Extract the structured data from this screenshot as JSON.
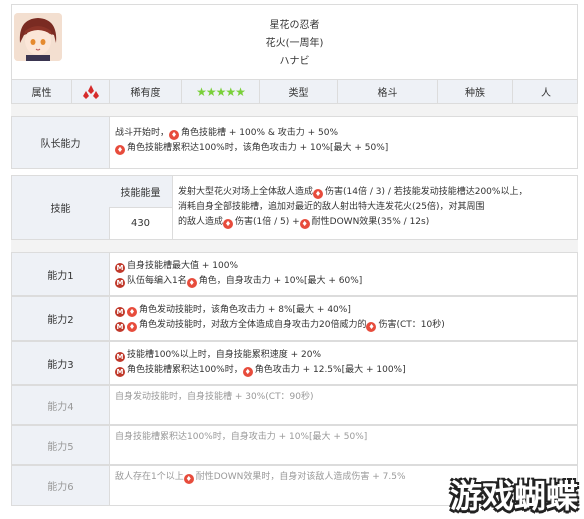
{
  "header": {
    "name_cn": "星花の忍者",
    "name_title": "花火(一周年)",
    "name_kana": "ハナビ"
  },
  "attrs": {
    "attr_label": "属性",
    "rarity_label": "稀有度",
    "stars": "★★★★★",
    "type_label": "类型",
    "type_value": "格斗",
    "race_label": "种族",
    "race_value": "人"
  },
  "leader": {
    "label": "队长能力",
    "line1_a": "战斗开始时，",
    "line1_b": "角色技能槽 + 100% & 攻击力 + 50%",
    "line2_b": "角色技能槽累积达100%时，该角色攻击力 + 10%[最大 + 50%]"
  },
  "skill": {
    "label": "技能",
    "energy_label": "技能能量",
    "energy_value": "430",
    "line1": "发射大型花火对场上全体敌人造成",
    "line1_b": "伤害(14倍 / 3) / 若技能发动技能槽达200%以上，",
    "line2": "消耗自身全部技能槽，追加对最近的敌人射出特大连发花火(25倍)，对其周围",
    "line3_a": "的敌人造成",
    "line3_b": "伤害(1倍 / 5) +",
    "line3_c": "耐性DOWN效果(35% / 12s)"
  },
  "abilities": [
    {
      "label": "能力1",
      "lines": [
        "自身技能槽最大值 + 100%",
        "队伍每编入1名",
        "角色，自身攻击力 + 10%[最大 + 60%]"
      ]
    },
    {
      "label": "能力2",
      "lines": [
        "角色发动技能时，该角色攻击力 + 8%[最大 + 40%]",
        "角色发动技能时，对敌方全体造成自身攻击力20倍威力的",
        "伤害(CT：10秒)"
      ]
    },
    {
      "label": "能力3",
      "lines": [
        "技能槽100%以上时，自身技能累积速度 + 20%",
        "角色技能槽累积达100%时，",
        "角色攻击力 + 12.5%[最大 + 100%]"
      ]
    },
    {
      "label": "能力4",
      "lines": [
        "自身发动技能时，自身技能槽 + 30%(CT：90秒)"
      ]
    },
    {
      "label": "能力5",
      "lines": [
        "自身技能槽累积达100%时，自身攻击力 + 10%[最大 + 50%]"
      ]
    },
    {
      "label": "能力6",
      "lines": [
        "敌人存在1个以上",
        "耐性DOWN效果时，自身对该敌人造成伤害 + 7.5%"
      ]
    }
  ],
  "watermark": "游戏蝴蝶",
  "colors": {
    "label_bg": "#eef1f6",
    "fire_icon": "#e74c3c",
    "m_icon": "#c0392b"
  }
}
